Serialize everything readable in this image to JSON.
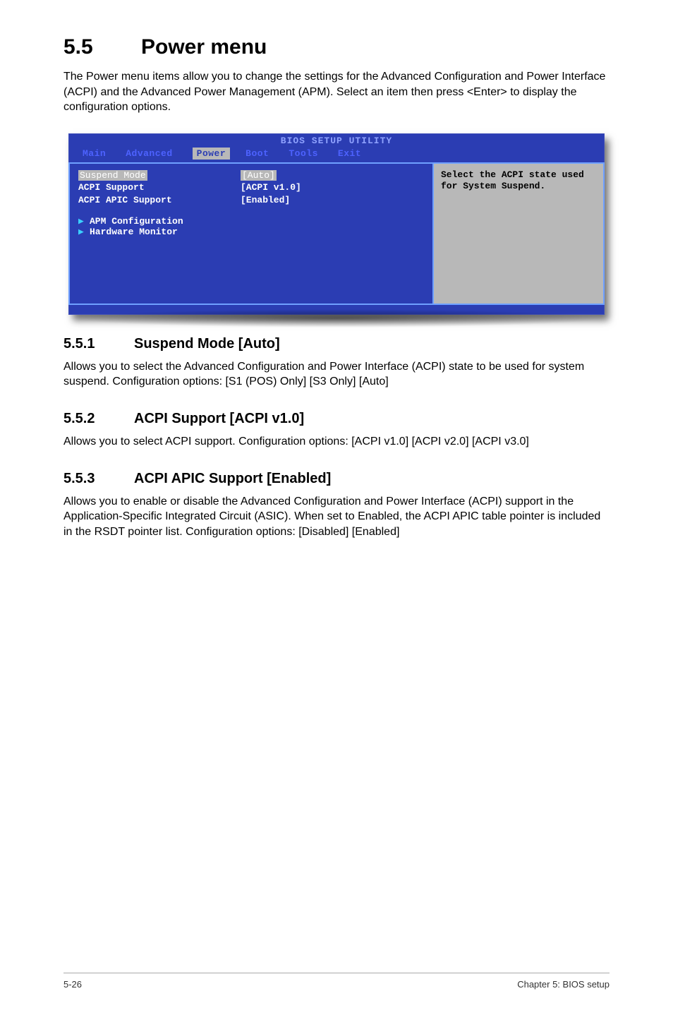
{
  "section": {
    "number": "5.5",
    "title": "Power menu",
    "intro": "The Power menu items allow you to change the settings for the Advanced Configuration and Power Interface (ACPI) and the Advanced Power Management (APM). Select an item then press <Enter> to display the configuration options."
  },
  "bios": {
    "title": "BIOS SETUP UTILITY",
    "tabs": [
      "Main",
      "Advanced",
      "Power",
      "Boot",
      "Tools",
      "Exit"
    ],
    "active_tab": "Power",
    "items": [
      {
        "label": "Suspend Mode",
        "value": "[Auto]",
        "selected": true
      },
      {
        "label": "ACPI Support",
        "value": "[ACPI v1.0]",
        "selected": false
      },
      {
        "label": "ACPI APIC Support",
        "value": "[Enabled]",
        "selected": false
      }
    ],
    "submenus": [
      "APM Configuration",
      "Hardware Monitor"
    ],
    "help": "Select the ACPI state used for System Suspend."
  },
  "subsections": [
    {
      "num": "5.5.1",
      "title": "Suspend Mode [Auto]",
      "body": "Allows you to select the Advanced Configuration and Power Interface (ACPI) state to be used for system suspend. Configuration options: [S1 (POS) Only] [S3 Only] [Auto]"
    },
    {
      "num": "5.5.2",
      "title": "ACPI Support [ACPI v1.0]",
      "body": "Allows you to select ACPI support. Configuration options: [ACPI v1.0] [ACPI v2.0] [ACPI v3.0]"
    },
    {
      "num": "5.5.3",
      "title": "ACPI APIC Support [Enabled]",
      "body": "Allows you to enable or disable the Advanced Configuration and Power Interface (ACPI) support in the Application-Specific Integrated Circuit (ASIC). When set to Enabled, the ACPI APIC table pointer is included in the RSDT pointer list. Configuration options: [Disabled] [Enabled]"
    }
  ],
  "footer": {
    "left": "5-26",
    "right": "Chapter 5: BIOS setup"
  }
}
